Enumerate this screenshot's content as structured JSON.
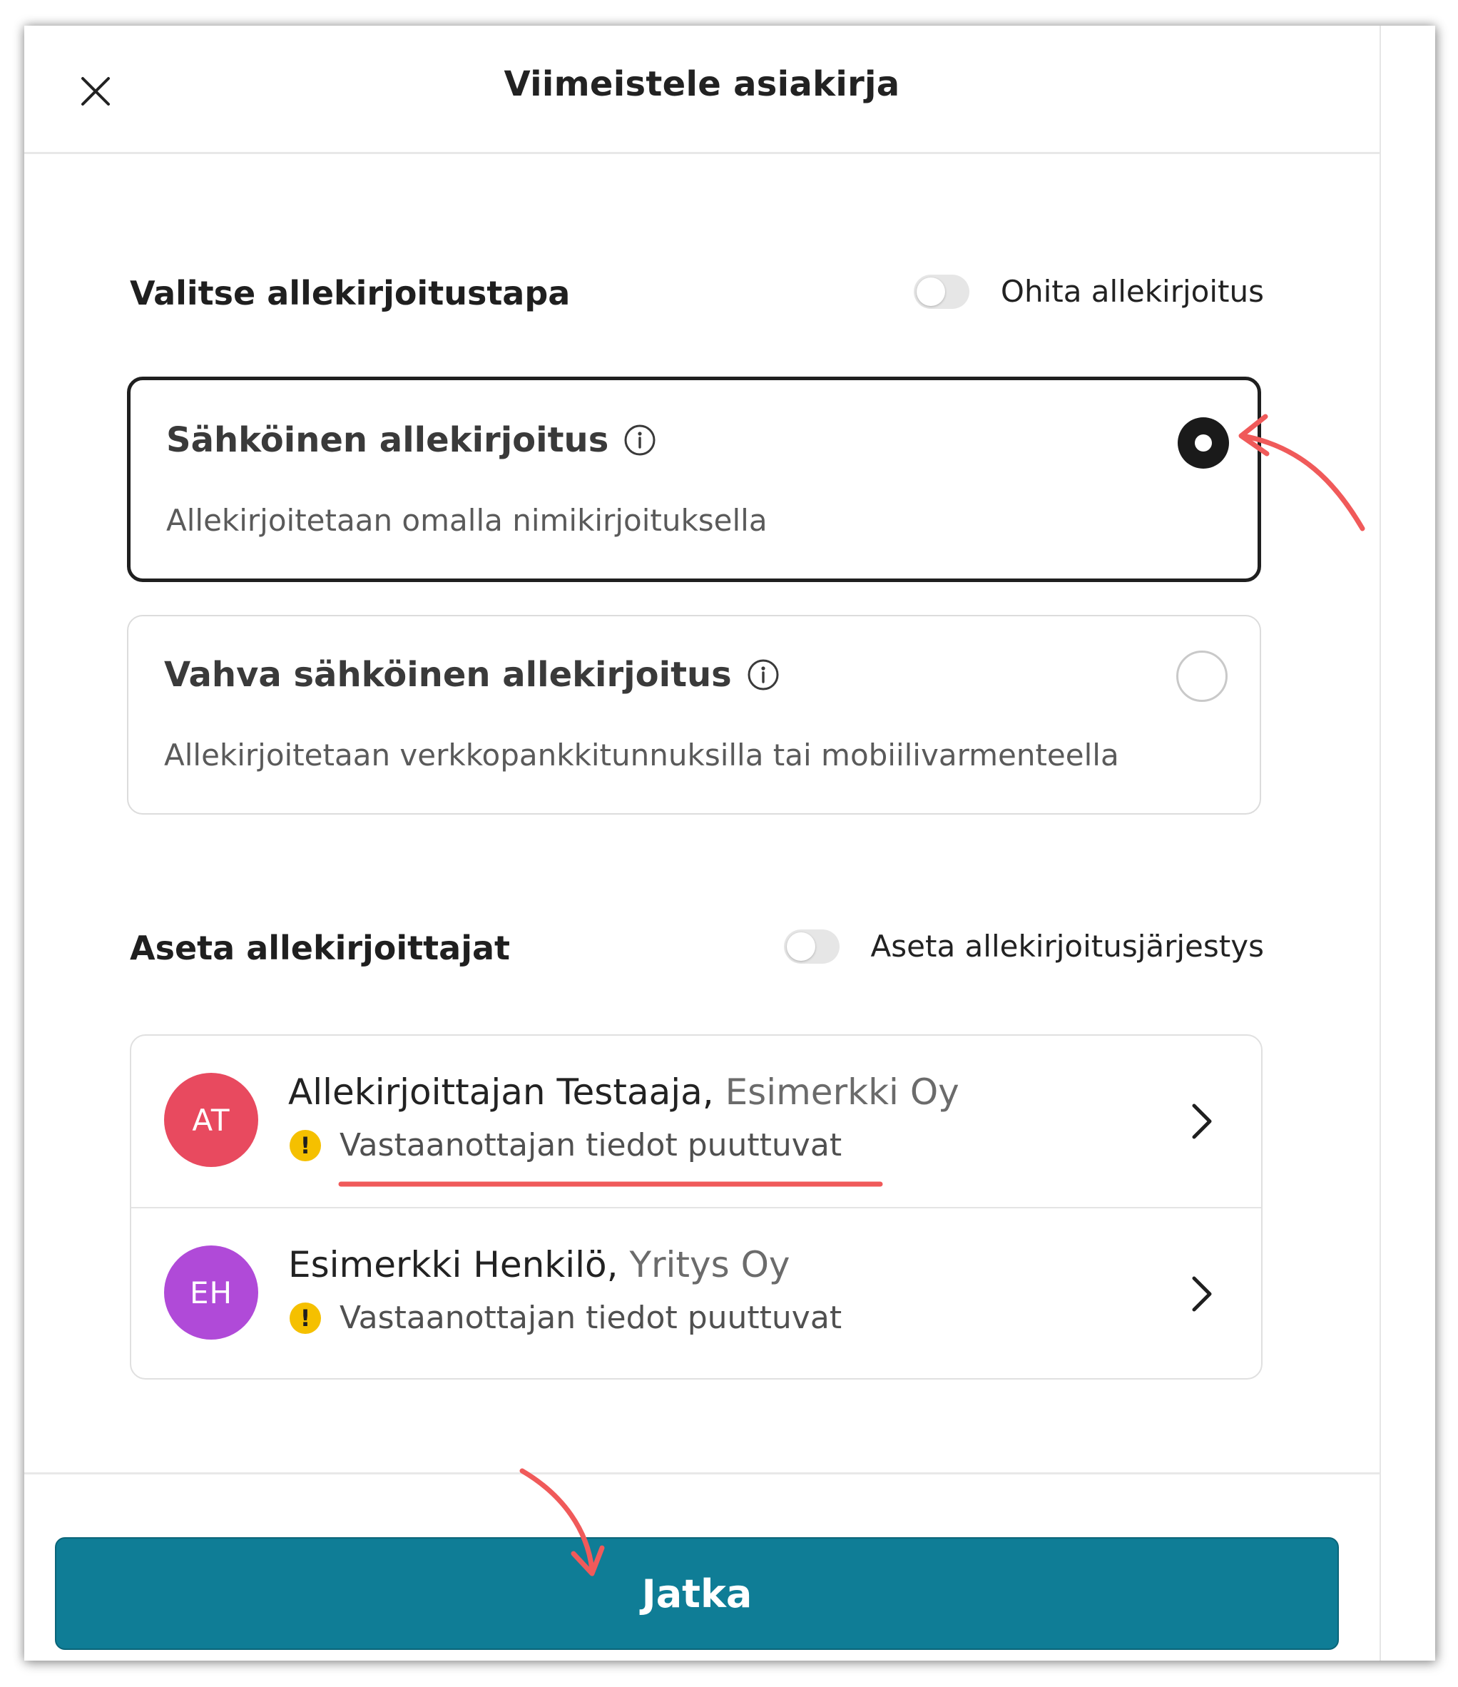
{
  "header": {
    "title": "Viimeistele asiakirja",
    "close_icon": "close-icon"
  },
  "signature_method": {
    "section_title": "Valitse allekirjoitustapa",
    "skip_toggle_label": "Ohita allekirjoitus",
    "skip_toggle_on": false,
    "options": [
      {
        "title": "Sähköinen allekirjoitus",
        "description": "Allekirjoitetaan omalla nimikirjoituksella",
        "selected": true
      },
      {
        "title": "Vahva sähköinen allekirjoitus",
        "description": "Allekirjoitetaan verkkopankkitunnuksilla tai mobiilivarmenteella",
        "selected": false
      }
    ]
  },
  "signers": {
    "section_title": "Aseta allekirjoittajat",
    "order_toggle_label": "Aseta allekirjoitusjärjestys",
    "order_toggle_on": false,
    "items": [
      {
        "initials": "AT",
        "name": "Allekirjoittajan Testaaja,",
        "company": "Esimerkki Oy",
        "warning": "Vastaanottajan tiedot puuttuvat",
        "avatar_color": "#e84a5f"
      },
      {
        "initials": "EH",
        "name": "Esimerkki Henkilö,",
        "company": "Yritys Oy",
        "warning": "Vastaanottajan tiedot puuttuvat",
        "avatar_color": "#b04ad8"
      }
    ]
  },
  "footer": {
    "continue_label": "Jatka"
  },
  "colors": {
    "primary": "#0f7d96",
    "warning": "#f5c000",
    "annotation": "#f05a5a"
  }
}
